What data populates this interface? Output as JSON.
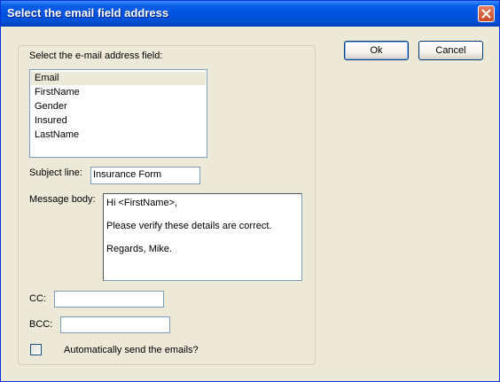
{
  "window": {
    "title": "Select the email field address"
  },
  "group": {
    "field_label": "Select the e-mail address field:",
    "fields": [
      "Email",
      "FirstName",
      "Gender",
      "Insured",
      "LastName"
    ],
    "subject_label": "Subject line:",
    "subject_value": "Insurance Form",
    "message_label": "Message body:",
    "message_lines": [
      "Hi <FirstName>,",
      "Please verify these details are correct.",
      "Regards, Mike."
    ],
    "cc_label": "CC:",
    "cc_value": "",
    "bcc_label": "BCC:",
    "bcc_value": "",
    "auto_send_label": "Automatically send the emails?",
    "auto_send_checked": false
  },
  "buttons": {
    "ok": "Ok",
    "cancel": "Cancel"
  },
  "icons": {
    "close": "close-icon"
  },
  "colors": {
    "title_bar": "#0054e3",
    "close_button": "#d6562f",
    "dialog_bg": "#ece9d8",
    "selection": "#ece9d8"
  }
}
